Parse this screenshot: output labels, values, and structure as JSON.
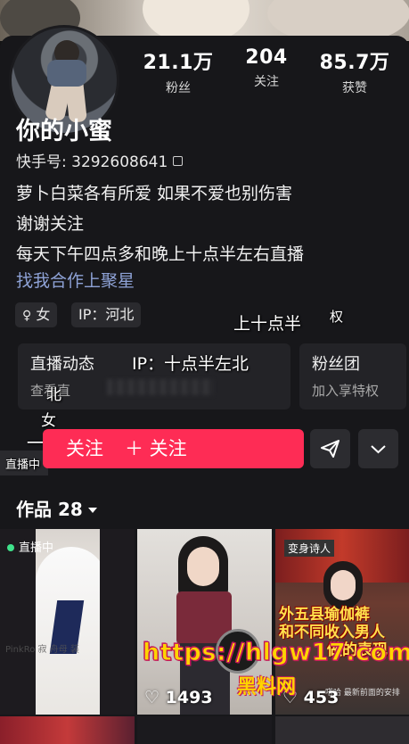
{
  "profile": {
    "followers_count": "21.1万",
    "followers_label": "粉丝",
    "following_count": "204",
    "following_label": "关注",
    "likes_count": "85.7万",
    "likes_label": "获赞",
    "name": "你的小蜜",
    "kuaishou_id": "快手号: 3292608641",
    "bio_line1": "萝卜白菜各有所爱 如果不爱也别伤害",
    "bio_line2": "谢谢关注",
    "bio_line3": "每天下午四点多和晚上十点半左右直播",
    "cooperation_link": "找我合作上聚星",
    "gender_tag": "女",
    "ip_tag": "IP：河北"
  },
  "cards": {
    "live_title": "直播动态",
    "live_subtitle": "查看直",
    "fans_title": "粉丝团",
    "fans_subtitle": "加入享特权"
  },
  "overlays": {
    "floating_1": "上十点半",
    "floating_2": "权",
    "floating_3": "IP：十点半左北",
    "floating_4": "北",
    "floating_5": "女",
    "floating_6": "一",
    "floating_7": "直播中"
  },
  "actions": {
    "follow_label_left": "关注",
    "follow_label": "＋ 关注"
  },
  "works": {
    "label": "作品 28",
    "items": [
      {
        "badge": "直播中",
        "likes": "",
        "caption": "PinkRo 寂 舟母 装"
      },
      {
        "badge": "",
        "likes": "1493",
        "caption": ""
      },
      {
        "badge": "",
        "likes": "453",
        "caption_top": "变身诗人",
        "caption_yellow_1": "外五县瑜伽裤",
        "caption_yellow_2": "和不同收入男人",
        "caption_yellow_3": "做的表现",
        "caption_small": "嗒哈 最新前面的安排"
      }
    ]
  },
  "watermark": {
    "url": "https://hlgw17.com",
    "site": "黑料网"
  },
  "colors": {
    "accent": "#fe2c55",
    "link": "#8ea2d6",
    "live_dot": "#3fe28b"
  }
}
